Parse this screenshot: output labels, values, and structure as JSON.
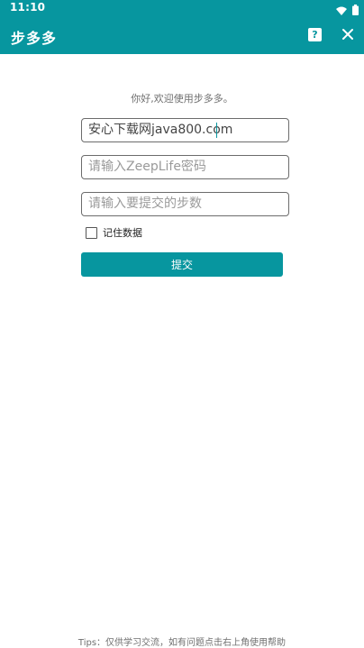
{
  "status_bar": {
    "time": "11:10",
    "icons": [
      "wifi-icon",
      "battery-icon"
    ]
  },
  "app_bar": {
    "title": "步多多",
    "help_label": "?",
    "icons": [
      "help-icon",
      "close-icon"
    ]
  },
  "main": {
    "welcome": "你好,欢迎使用步多多。",
    "account_field": {
      "value": "安心下载网java800.com",
      "placeholder": ""
    },
    "password_field": {
      "value": "",
      "placeholder": "请输入ZeepLife密码"
    },
    "steps_field": {
      "value": "",
      "placeholder": "请输入要提交的步数"
    },
    "remember_label": "记住数据",
    "remember_checked": false,
    "submit_label": "提交"
  },
  "footer": {
    "tips": "Tips：仅供学习交流，如有问题点击右上角使用帮助"
  },
  "colors": {
    "accent": "#07969f",
    "background": "#ffffff"
  }
}
